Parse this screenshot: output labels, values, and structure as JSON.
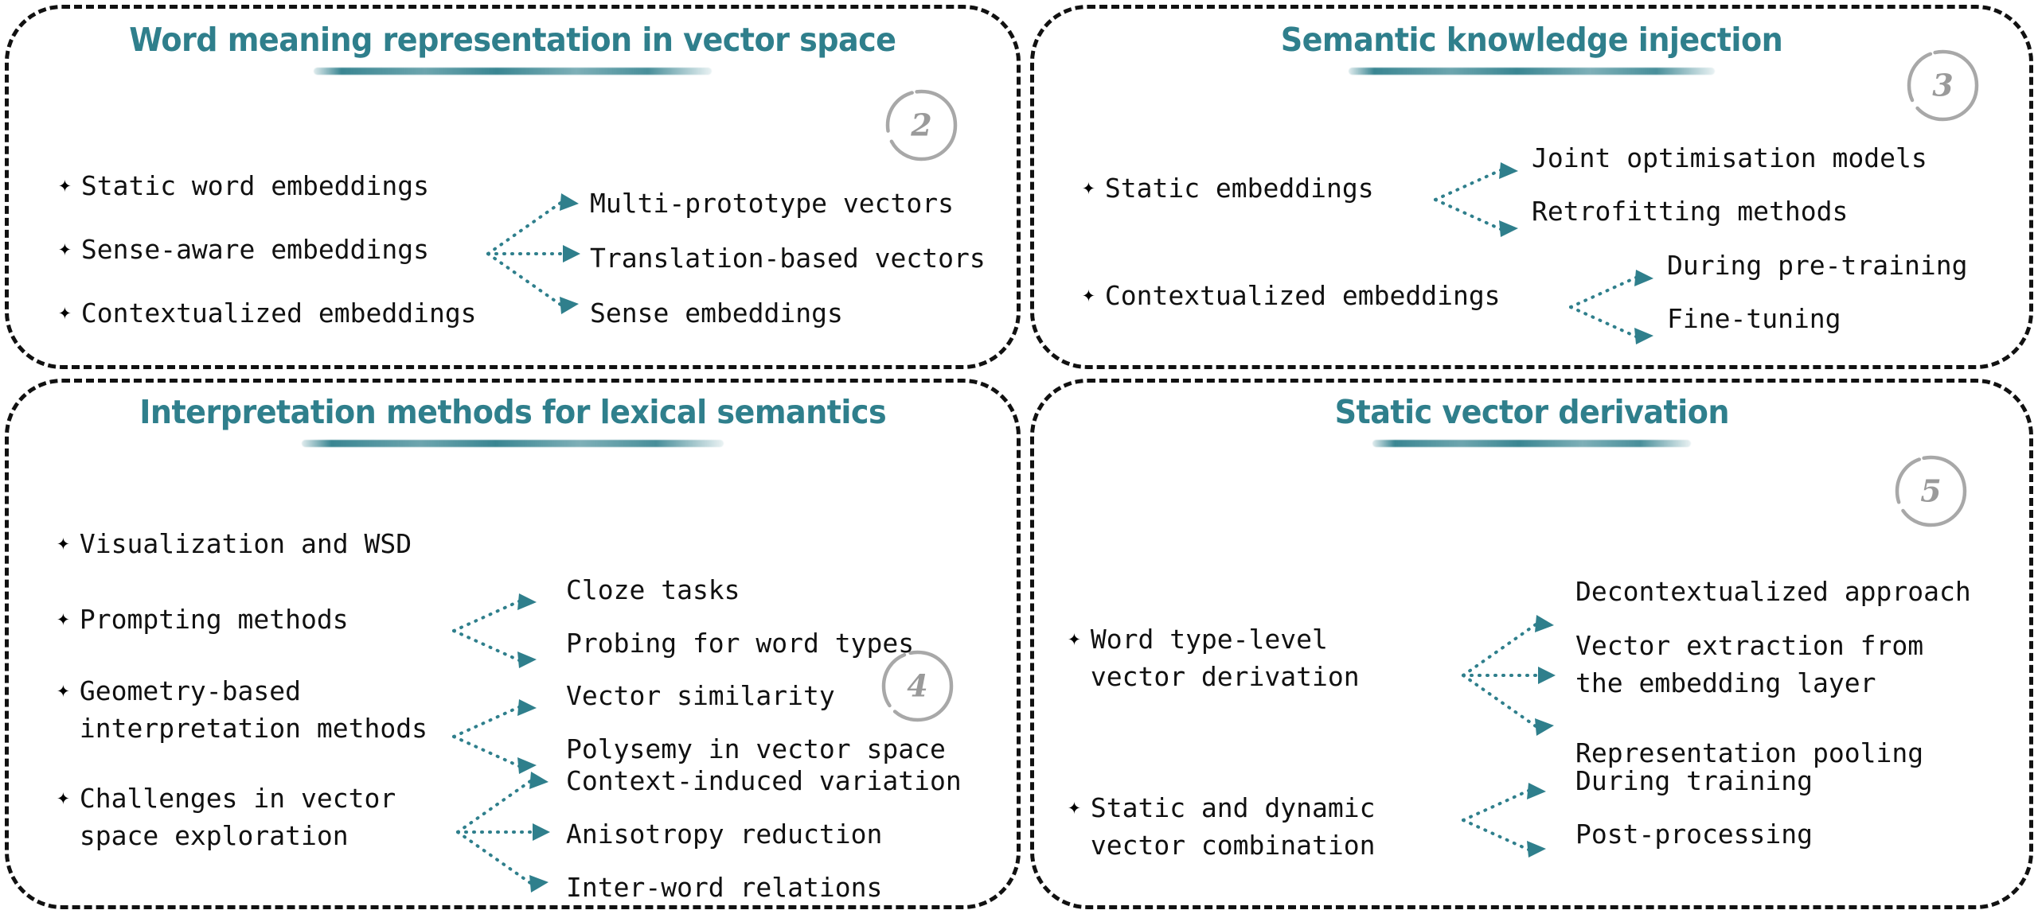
{
  "colors": {
    "accent_teal": "#2f7f8c",
    "border_black": "#111111",
    "badge_gray": "#9a9a9a",
    "text_black": "#111111"
  },
  "panels": [
    {
      "id": "word-meaning-representation",
      "number": "2",
      "title": "Word meaning representation in vector space",
      "items": [
        {
          "label": "Static word embeddings",
          "children": []
        },
        {
          "label": "Sense-aware embeddings",
          "children": [
            "Multi-prototype vectors",
            "Translation-based vectors",
            "Sense embeddings"
          ]
        },
        {
          "label": "Contextualized embeddings",
          "children": []
        }
      ]
    },
    {
      "id": "semantic-knowledge-injection",
      "number": "3",
      "title": "Semantic knowledge injection",
      "items": [
        {
          "label": "Static embeddings",
          "children": [
            "Joint optimisation models",
            "Retrofitting methods"
          ]
        },
        {
          "label": "Contextualized embeddings",
          "children": [
            "During pre-training",
            "Fine-tuning"
          ]
        }
      ]
    },
    {
      "id": "interpretation-methods",
      "number": "4",
      "title": "Interpretation methods for lexical semantics",
      "items": [
        {
          "label": "Visualization and WSD",
          "children": []
        },
        {
          "label": "Prompting methods",
          "children": [
            "Cloze tasks",
            "Probing for word types"
          ]
        },
        {
          "label": "Geometry-based\ninterpretation methods",
          "children": [
            "Vector similarity",
            "Polysemy in vector space"
          ]
        },
        {
          "label": "Challenges in vector\nspace exploration",
          "children": [
            "Context-induced variation",
            "Anisotropy reduction",
            "Inter-word relations"
          ]
        }
      ]
    },
    {
      "id": "static-vector-derivation",
      "number": "5",
      "title": "Static vector derivation",
      "items": [
        {
          "label": "Word type-level\nvector derivation",
          "children": [
            "Decontextualized approach",
            "Vector extraction from\nthe embedding layer",
            "Representation pooling"
          ]
        },
        {
          "label": "Static and dynamic\nvector combination",
          "children": [
            "During training",
            "Post-processing"
          ]
        }
      ]
    }
  ],
  "bullet_glyph": "✦"
}
